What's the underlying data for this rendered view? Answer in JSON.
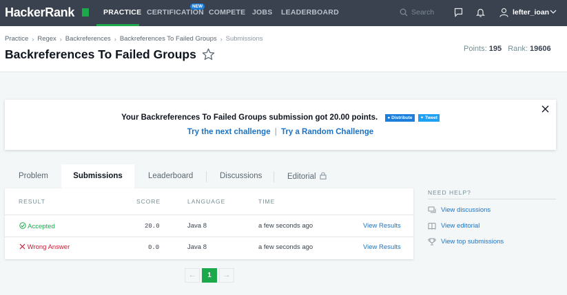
{
  "navbar": {
    "logo": "HackerRank",
    "items": [
      "PRACTICE",
      "CERTIFICATION",
      "COMPETE",
      "JOBS",
      "LEADERBOARD"
    ],
    "new_badge": "NEW",
    "search_placeholder": "Search",
    "username": "lefter_ioan",
    "icons": [
      "search-icon",
      "messages-icon",
      "notifications-bell-icon",
      "user-icon",
      "chevron-down-icon"
    ]
  },
  "breadcrumb": [
    "Practice",
    "Regex",
    "Backreferences",
    "Backreferences To Failed Groups",
    "Submissions"
  ],
  "challenge": {
    "title": "Backreferences To Failed Groups",
    "points_label": "Points:",
    "points": "195",
    "rank_label": "Rank:",
    "rank": "19606"
  },
  "banner": {
    "message": "Your Backreferences To Failed Groups submission got 20.00 points.",
    "share_facebook": "Distribute",
    "share_twitter": "Tweet",
    "link_next": "Try the next challenge",
    "separator": "|",
    "link_random": "Try a Random Challenge"
  },
  "tabs": [
    "Problem",
    "Submissions",
    "Leaderboard",
    "Discussions",
    "Editorial"
  ],
  "active_tab": "Submissions",
  "table": {
    "headers": [
      "RESULT",
      "SCORE",
      "LANGUAGE",
      "TIME"
    ],
    "rows": [
      {
        "result": "Accepted",
        "score": "20.0",
        "language": "Java 8",
        "time": "a few seconds ago",
        "action": "View Results"
      },
      {
        "result": "Wrong Answer",
        "score": "0.0",
        "language": "Java 8",
        "time": "a few seconds ago",
        "action": "View Results"
      }
    ]
  },
  "pagination": {
    "prev": "←",
    "current": "1",
    "next": "→"
  },
  "help": {
    "title": "NEED HELP?",
    "items": [
      "View discussions",
      "View editorial",
      "View top submissions"
    ]
  },
  "colors": {
    "brand_green": "#1ba94c",
    "navbar": "#39424e",
    "link": "#1a73c6",
    "error": "#d11534"
  }
}
